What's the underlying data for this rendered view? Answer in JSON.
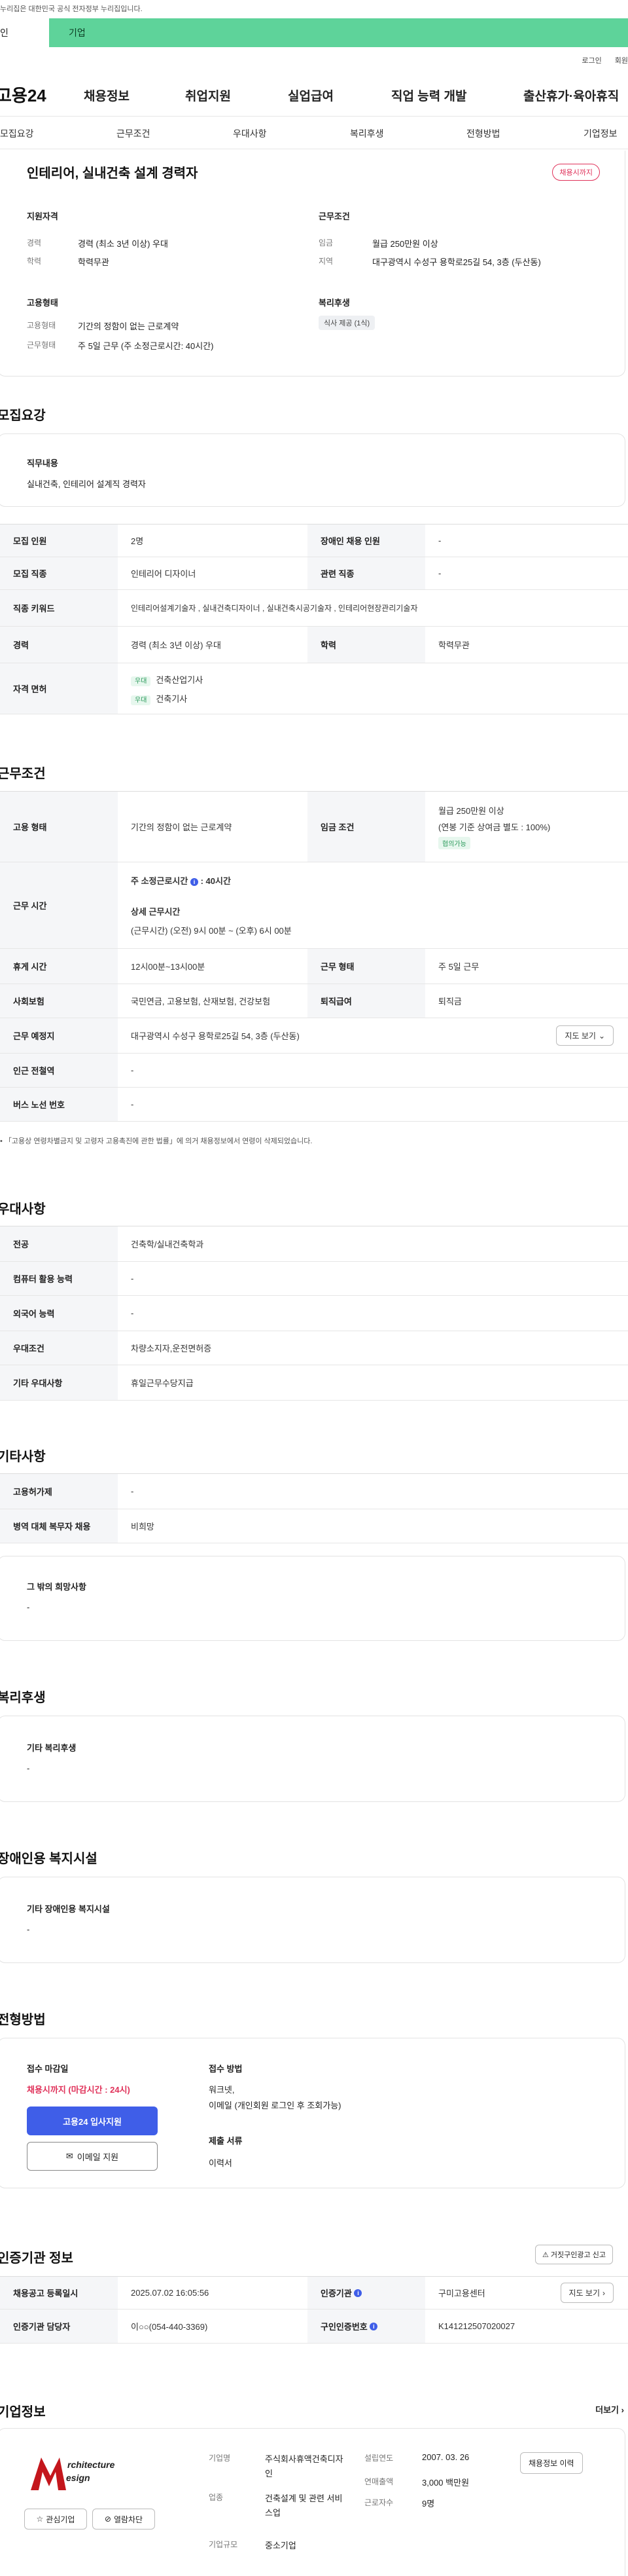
{
  "banner": {
    "notice": "누리집은 대한민국 공식 전자정부 누리집입니다."
  },
  "tabs": [
    "인",
    "기업"
  ],
  "util": [
    "로그인",
    "회원"
  ],
  "logo": "고용24",
  "gnb": [
    "채용정보",
    "취업지원",
    "실업급여",
    "직업 능력 개발",
    "출산휴가·육아휴직"
  ],
  "subnav": [
    "모집요강",
    "근무조건",
    "우대사항",
    "복리후생",
    "전형방법",
    "기업정보"
  ],
  "summary": {
    "title": "인테리어, 실내건축 설계 경력자",
    "deadline_badge": "채용시까지",
    "qual_heading": "지원자격",
    "career_label": "경력",
    "career_value": "경력 (최소 3년 이상) 우대",
    "edu_label": "학력",
    "edu_value": "학력무관",
    "work_heading": "근무조건",
    "wage_label": "임금",
    "wage_value": "월급 250만원 이상",
    "region_label": "지역",
    "region_value": "대구광역시 수성구 용학로25길 54, 3층 (두산동)",
    "emp_heading": "고용형태",
    "emptype_label": "고용형태",
    "emptype_value": "기간의 정함이 없는 근로계약",
    "worktype_label": "근무형태",
    "worktype_value": "주 5일 근무 (주 소정근로시간: 40시간)",
    "welfare_heading": "복리후생",
    "welfare_badge": "식사 제공 (1식)"
  },
  "recruit": {
    "heading": "모집요강",
    "duty_label": "직무내용",
    "duty_value": "실내건축, 인테리어 설계직 경력자",
    "rows": [
      {
        "l1": "모집 인원",
        "v1": "2명",
        "l2": "장애인 채용 인원",
        "v2": "-"
      },
      {
        "l1": "모집 직종",
        "v1": "인테리어 디자이너",
        "l2": "관련 직종",
        "v2": "-"
      },
      {
        "l1": "직종 키워드",
        "v1": "인테리어설계기술자 , 실내건축디자이너 , 실내건축시공기술자 , 인테리어현장관리기술자"
      },
      {
        "l1": "경력",
        "v1": "경력 (최소 3년 이상) 우대",
        "l2": "학력",
        "v2": "학력무관"
      }
    ],
    "license_label": "자격 면허",
    "licenses": [
      {
        "chip": "우대",
        "name": "건축산업기사"
      },
      {
        "chip": "우대",
        "name": "건축기사"
      }
    ]
  },
  "work": {
    "heading": "근무조건",
    "emptype_label": "고용 형태",
    "emptype_value": "기간의 정함이 없는 근로계약",
    "wage_label": "임금 조건",
    "wage_value": "월급 250만원 이상",
    "wage_sub": "(연봉 기준 상여금 별도 : 100%)",
    "wage_chip": "협의가능",
    "hours_label": "근무 시간",
    "hours_week_label": "주 소정근로시간",
    "hours_week_value": ": 40시간",
    "hours_detail_label": "상세 근무시간",
    "hours_detail_value": "(근무시간) (오전) 9시 00분 ~ (오후) 6시 00분",
    "rest_label": "휴게 시간",
    "rest_value": "12시00분~13시00분",
    "form_label": "근무 형태",
    "form_value": "주 5일 근무",
    "ins_label": "사회보험",
    "ins_value": "국민연금, 고용보험, 산재보험, 건강보험",
    "sev_label": "퇴직급여",
    "sev_value": "퇴직금",
    "place_label": "근무 예정지",
    "place_value": "대구광역시 수성구 용학로25길 54, 3층 (두산동)",
    "map_btn": "지도 보기",
    "subway_label": "인근 전철역",
    "subway_value": "-",
    "bus_label": "버스 노선 번호",
    "bus_value": "-",
    "note": "「고용상 연령차별금지 및 고령자 고용촉진에 관한 법률」에 의거 채용정보에서 연령이 삭제되었습니다."
  },
  "pref": {
    "heading": "우대사항",
    "rows": [
      {
        "l": "전공",
        "v": "건축학/실내건축학과"
      },
      {
        "l": "컴퓨터 활용 능력",
        "v": "-"
      },
      {
        "l": "외국어 능력",
        "v": "-"
      },
      {
        "l": "우대조건",
        "v": "차량소지자,운전면허증"
      },
      {
        "l": "기타 우대사항",
        "v": "휴일근무수당지급"
      }
    ]
  },
  "etc": {
    "heading": "기타사항",
    "rows": [
      {
        "l": "고용허가제",
        "v": "-"
      },
      {
        "l": "병역 대체 복무자 채용",
        "v": "비희망"
      }
    ],
    "wish_label": "그 밖의 희망사항",
    "wish_value": "-"
  },
  "benefit": {
    "heading": "복리후생",
    "label": "기타 복리후생",
    "value": "-"
  },
  "disabled": {
    "heading": "장애인용 복지시설",
    "label": "기타 장애인용 복지시설",
    "value": "-"
  },
  "process": {
    "heading": "전형방법",
    "deadline_label": "접수 마감일",
    "deadline_value": "채용시까지 (마감시간 : 24시)",
    "apply_btn": "고용24 입사지원",
    "email_btn": "이메일 지원",
    "method_label": "접수 방법",
    "method_value1": "워크넷,",
    "method_value2": "이메일 (개인회원 로그인 후 조회가능)",
    "docs_label": "제출 서류",
    "docs_value": "이력서"
  },
  "cert": {
    "heading": "인증기관 정보",
    "report_btn": "거짓구인광고 신고",
    "reg_label": "채용공고 등록일시",
    "reg_value": "2025.07.02 16:05:56",
    "org_label": "인증기관",
    "org_value": "구미고용센터",
    "map_btn": "지도 보기",
    "staff_label": "인증기관 담당자",
    "staff_value": "이○○(054-440-3369)",
    "no_label": "구인인증번호",
    "no_value": "K141212507020027"
  },
  "company": {
    "heading": "기업정보",
    "more": "더보기",
    "logo_text1": "rchitecture",
    "logo_text2": "esign",
    "fav_btn": "관심기업",
    "block_btn": "열람차단",
    "name_label": "기업명",
    "name_value": "주식회사휴액건축디자인",
    "biz_label": "업종",
    "biz_value": "건축설계 및 관련 서비스업",
    "size_label": "기업규모",
    "size_value": "중소기업",
    "est_label": "설립연도",
    "est_value": "2007. 03. 26",
    "sales_label": "연매출액",
    "sales_value": "3,000 백만원",
    "emp_label": "근로자수",
    "emp_value": "9명",
    "info_btn": "채용정보 이력"
  },
  "colors": {
    "accent": "#5ed39a",
    "red": "#e0325a",
    "blue": "#3f5ee8"
  }
}
